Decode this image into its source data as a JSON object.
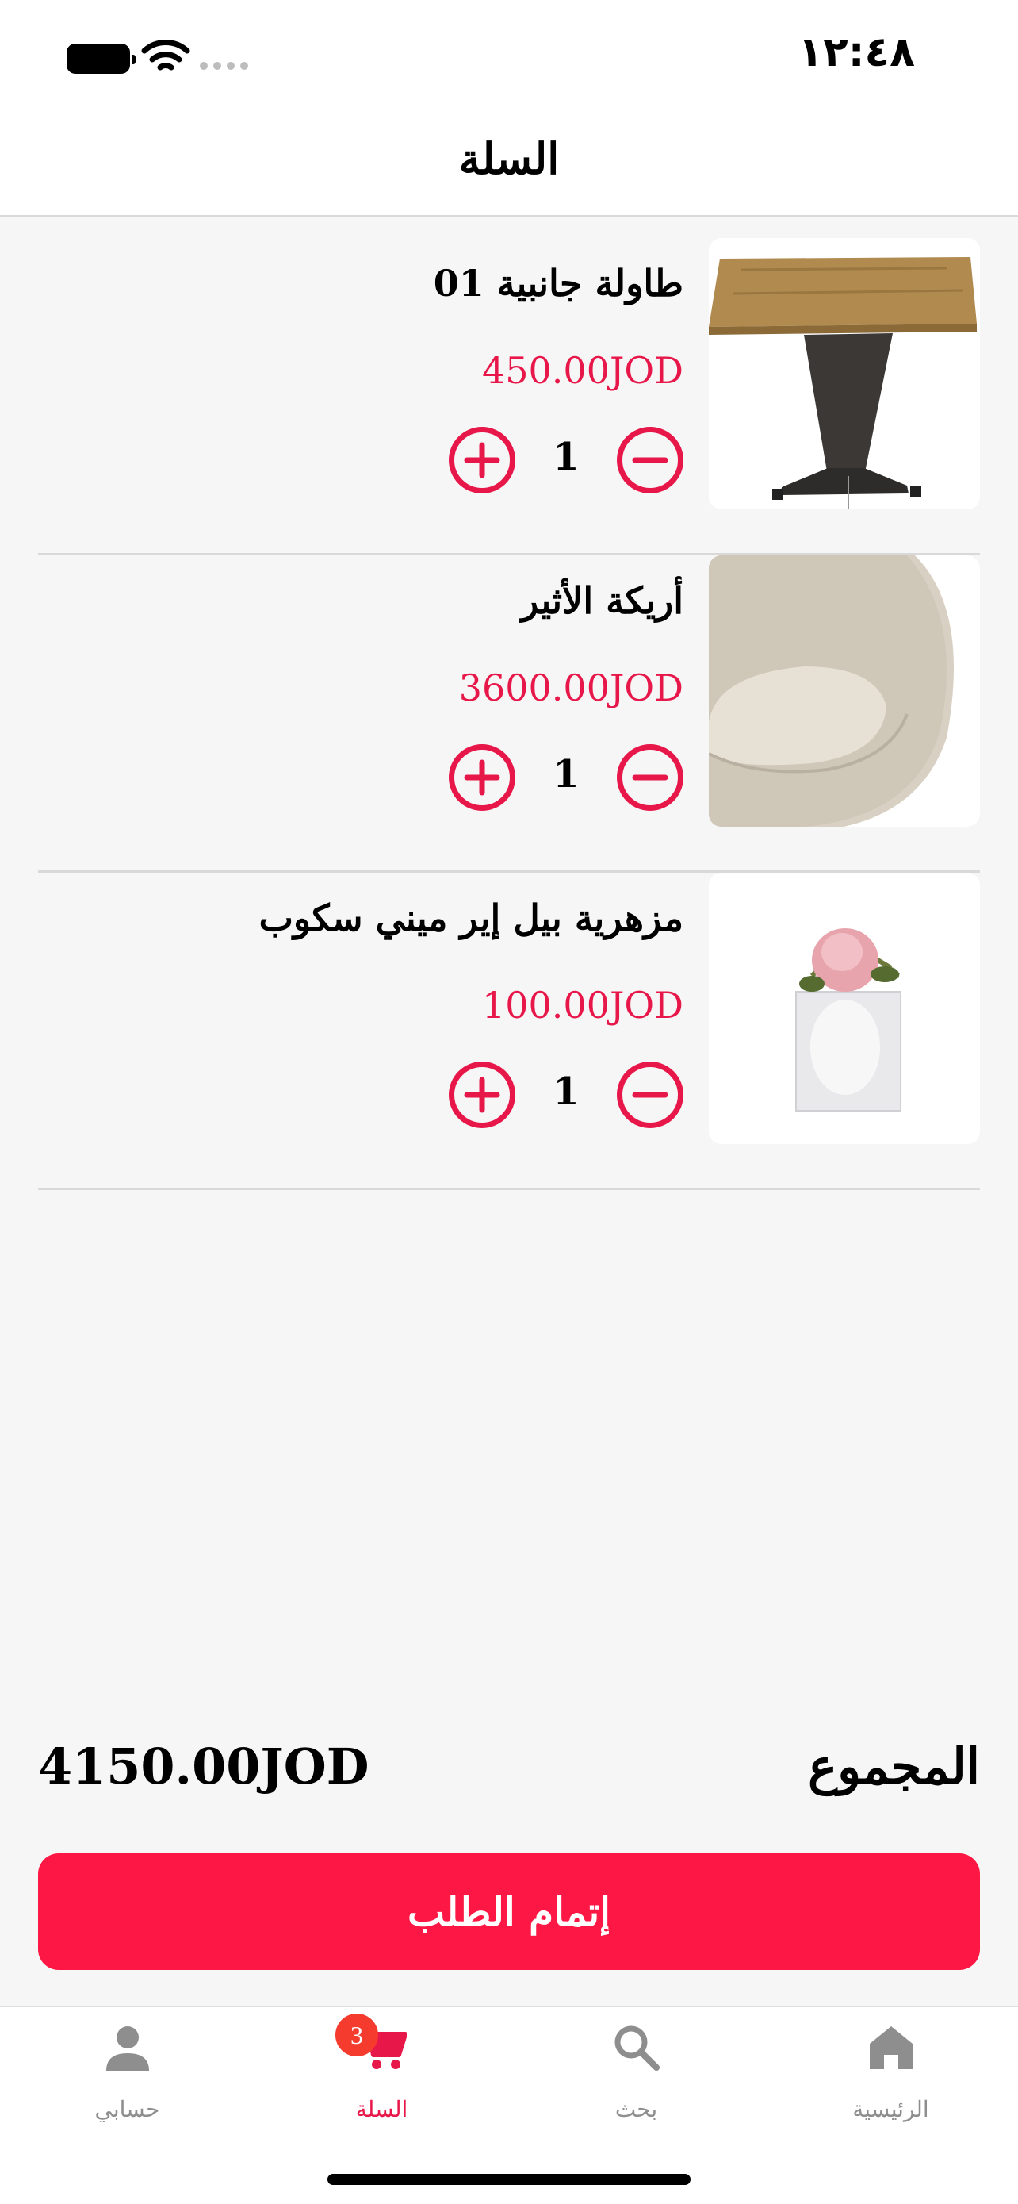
{
  "status_bar": {
    "time": "١٢:٤٨"
  },
  "header": {
    "title": "السلة"
  },
  "cart": {
    "items": [
      {
        "name": "طاولة جانبية 01",
        "price": "450.00JOD",
        "quantity": "1",
        "image": "side-table"
      },
      {
        "name": "أريكة الأثير",
        "price": "3600.00JOD",
        "quantity": "1",
        "image": "beige-armchair"
      },
      {
        "name": "مزهرية بيل إير ميني سكوب",
        "price": "100.00JOD",
        "quantity": "1",
        "image": "flower-vase"
      }
    ]
  },
  "summary": {
    "total_label": "المجموع",
    "total_value": "4150.00JOD"
  },
  "checkout": {
    "label": "إتمام الطلب"
  },
  "tabbar": {
    "tabs": [
      {
        "label": "الرئيسية",
        "icon": "home-icon"
      },
      {
        "label": "بحث",
        "icon": "search-icon"
      },
      {
        "label": "السلة",
        "icon": "cart-icon",
        "badge": "3",
        "active": true
      },
      {
        "label": "حسابي",
        "icon": "person-icon"
      }
    ]
  },
  "colors": {
    "accent": "#e8174a",
    "button": "#fd1744",
    "badge": "#f43b2e",
    "inactive": "#8e8e8e"
  }
}
